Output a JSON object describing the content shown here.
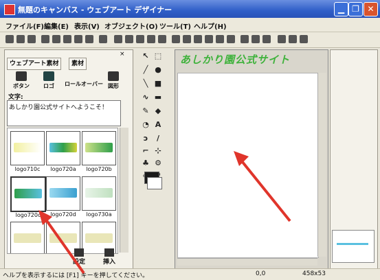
{
  "window": {
    "title": "無題のキャンバス - ウェブアート デザイナー"
  },
  "menu": [
    "ファイル(F)",
    "編集(E)",
    "表示(V)",
    "オブジェクト(O)",
    "ツール(T)",
    "ヘルプ(H)"
  ],
  "panel_left": {
    "tabs": [
      "ウェブアート素材",
      "素材"
    ],
    "type_buttons": [
      "ボタン",
      "ロゴ",
      "ロールオーバー",
      "図形"
    ],
    "text_label": "文字:",
    "text_value": "あしかり園公式サイトへようこそ！",
    "thumbnails": [
      "logo710c",
      "logo720a",
      "logo720b",
      "logo720c",
      "logo720d",
      "logo730a"
    ],
    "bottom_buttons": [
      "設定",
      "挿入"
    ]
  },
  "canvas": {
    "logo_text": "あしかり園公式サイト",
    "coords": "0,0",
    "size": "458x53"
  },
  "statusbar": {
    "help": "ヘルプを表示するには [F1] キーを押してください。"
  },
  "colors": {
    "titlebar": "#2f5ec8",
    "logo": "#3fb23c",
    "arrow": "#e0352b"
  }
}
